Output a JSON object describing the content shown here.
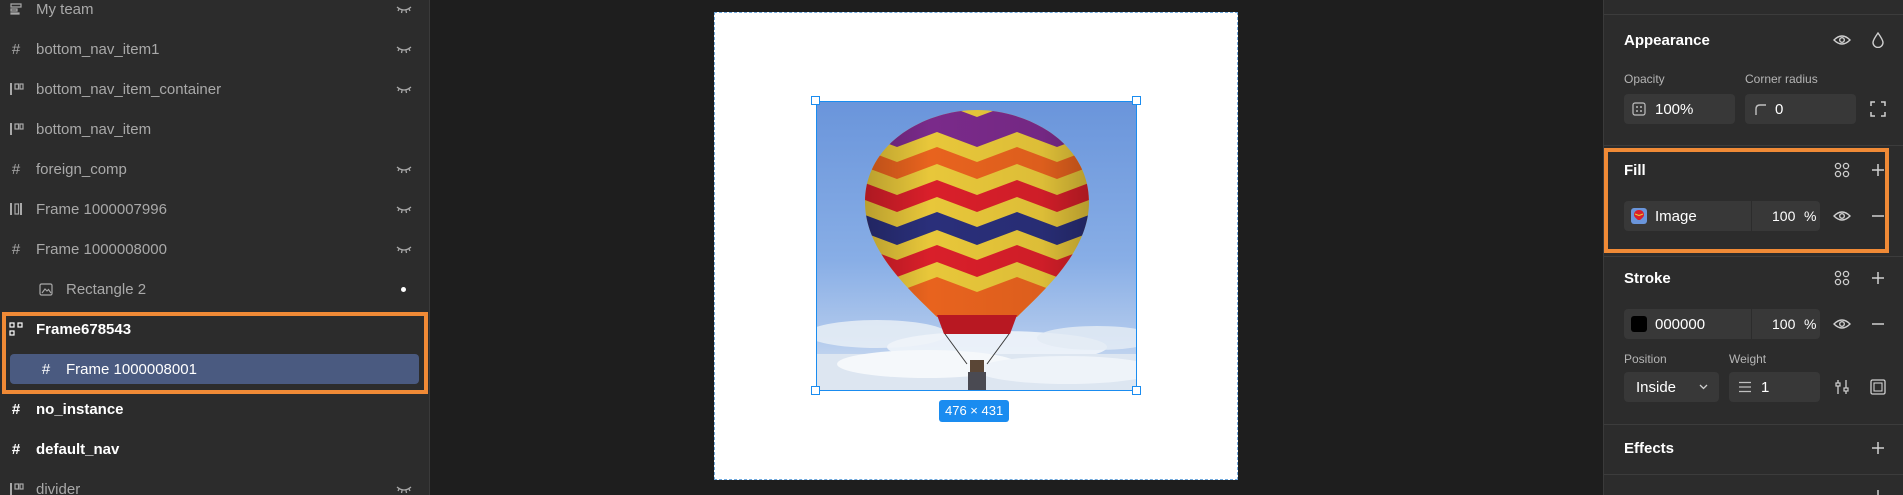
{
  "layers": [
    {
      "name": "My team",
      "icon": "text-lines-icon",
      "dim": true
    },
    {
      "name": "bottom_nav_item1",
      "icon": "frame-hash-icon",
      "dim": true
    },
    {
      "name": "bottom_nav_item_container",
      "icon": "autolayout-icon",
      "dim": true
    },
    {
      "name": "bottom_nav_item",
      "icon": "autolayout-icon",
      "dim": true
    },
    {
      "name": "foreign_comp",
      "icon": "frame-hash-icon",
      "dim": true
    },
    {
      "name": "Frame 1000007996",
      "icon": "autolayout-icon",
      "dim": true
    },
    {
      "name": "Frame 1000008000",
      "icon": "frame-hash-icon",
      "dim": true
    },
    {
      "name": "Rectangle 2",
      "icon": "image-icon",
      "dim": true
    },
    {
      "name": "Frame678543",
      "icon": "component-icon",
      "dim": false
    },
    {
      "name": "Frame 1000008001",
      "icon": "frame-hash-icon",
      "dim": false,
      "selected": true
    },
    {
      "name": "no_instance",
      "icon": "frame-hash-icon",
      "dim": false
    },
    {
      "name": "default_nav",
      "icon": "frame-hash-icon",
      "dim": false
    },
    {
      "name": "divider",
      "icon": "autolayout-icon",
      "dim": true
    }
  ],
  "canvas": {
    "size_label": "476 × 431"
  },
  "appearance": {
    "title": "Appearance",
    "opacity_label": "Opacity",
    "opacity_value": "100%",
    "radius_label": "Corner radius",
    "radius_value": "0"
  },
  "fill": {
    "title": "Fill",
    "type": "Image",
    "opacity": "100",
    "pct": "%"
  },
  "stroke": {
    "title": "Stroke",
    "color_hex": "000000",
    "opacity": "100",
    "pct": "%",
    "position_label": "Position",
    "position_value": "Inside",
    "weight_label": "Weight",
    "weight_value": "1"
  },
  "effects": {
    "title": "Effects"
  },
  "colors": {
    "accent": "#1a8cf0",
    "highlight": "#f08a36",
    "selection": "#4a5a80"
  }
}
